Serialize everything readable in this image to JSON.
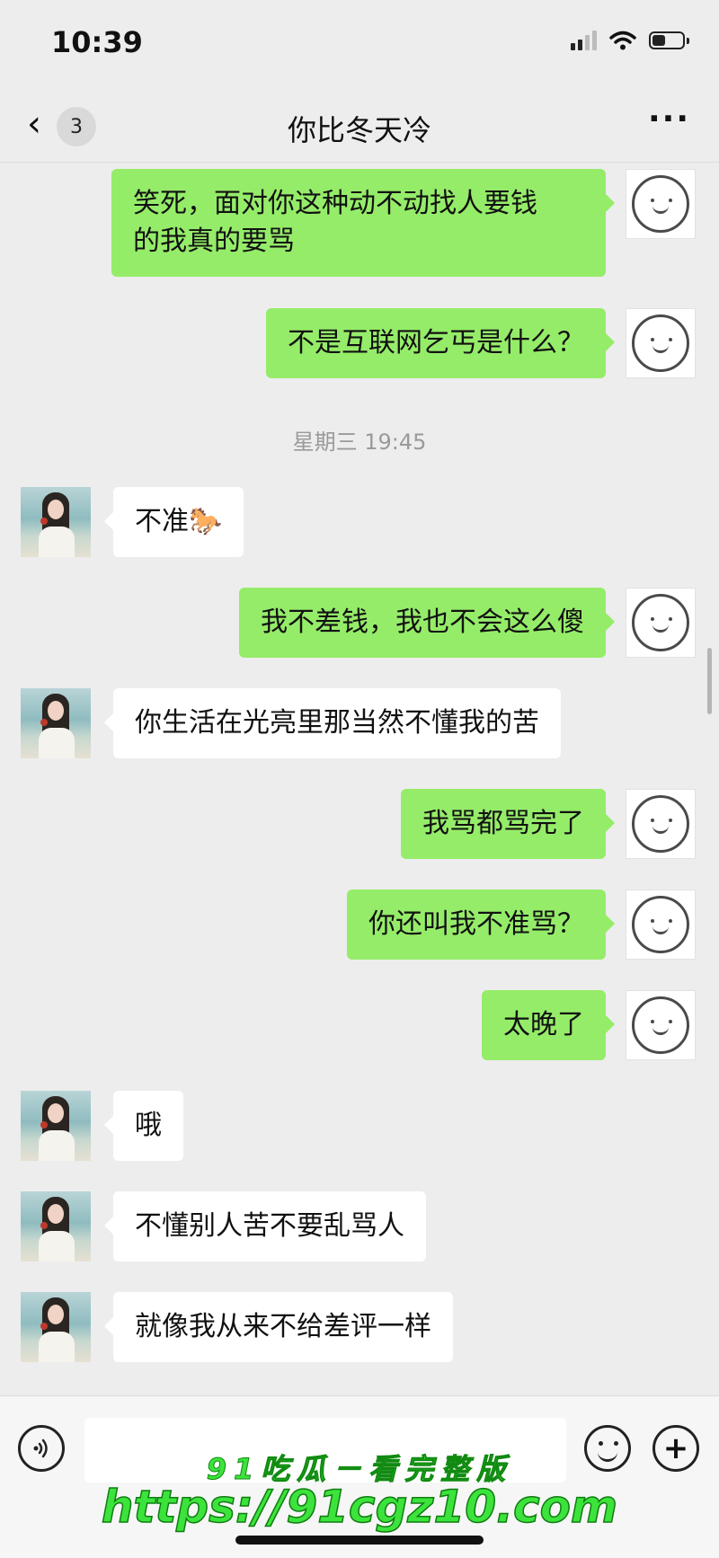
{
  "status_bar": {
    "time": "10:39",
    "battery_level": 0.45
  },
  "nav": {
    "back_icon": "chevron-left-icon",
    "unread_count": "3",
    "title": "你比冬天冷",
    "more_icon": "more-icon"
  },
  "timestamp": "星期三 19:45",
  "messages": [
    {
      "from": "me",
      "text": "笑死，面对你这种动不动找人要钱\n的我真的要骂"
    },
    {
      "from": "me",
      "text": "不是互联网乞丐是什么？"
    },
    {
      "from": "her",
      "text": "不准🐎"
    },
    {
      "from": "me",
      "text": "我不差钱，我也不会这么傻"
    },
    {
      "from": "her",
      "text": "你生活在光亮里那当然不懂我的苦"
    },
    {
      "from": "me",
      "text": "我骂都骂完了"
    },
    {
      "from": "me",
      "text": "你还叫我不准骂？"
    },
    {
      "from": "me",
      "text": "太晚了"
    },
    {
      "from": "her",
      "text": "哦"
    },
    {
      "from": "her",
      "text": "不懂别人苦不要乱骂人"
    },
    {
      "from": "her",
      "text": "就像我从来不给差评一样"
    }
  ],
  "input_bar": {
    "voice_icon": "voice-icon",
    "emoji_icon": "emoji-icon",
    "plus_icon": "plus-icon"
  },
  "watermark": {
    "line1": "91吃瓜－看完整版",
    "line2": "https://91cgz10.com"
  },
  "colors": {
    "my_bubble": "#95ec69",
    "their_bubble": "#ffffff",
    "background": "#ededed",
    "watermark": "#3ce33c"
  }
}
